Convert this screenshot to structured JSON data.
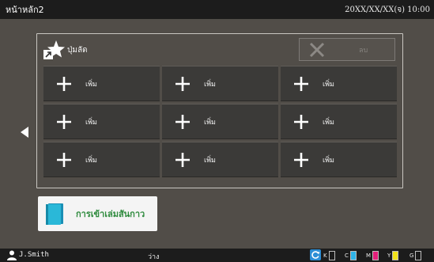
{
  "header": {
    "title": "หน้าหลัก2",
    "datetime": "20XX/XX/XX(จ) 10:00"
  },
  "shortcuts": {
    "title": "ปุ่มลัด",
    "delete_label": "ลบ",
    "delete_icon": "x-icon",
    "title_icon": "star-shortcut-icon",
    "tiles": [
      {
        "label": "เพิ่ม",
        "icon": "plus-icon"
      },
      {
        "label": "เพิ่ม",
        "icon": "plus-icon"
      },
      {
        "label": "เพิ่ม",
        "icon": "plus-icon"
      },
      {
        "label": "เพิ่ม",
        "icon": "plus-icon"
      },
      {
        "label": "เพิ่ม",
        "icon": "plus-icon"
      },
      {
        "label": "เพิ่ม",
        "icon": "plus-icon"
      },
      {
        "label": "เพิ่ม",
        "icon": "plus-icon"
      },
      {
        "label": "เพิ่ม",
        "icon": "plus-icon"
      },
      {
        "label": "เพิ่ม",
        "icon": "plus-icon"
      }
    ]
  },
  "navigation": {
    "prev_icon": "triangle-left-icon"
  },
  "booklet": {
    "label": "การเข้าเล่มสันกาว",
    "icon": "book-icon",
    "label_color": "#2d8a3c"
  },
  "status_bar": {
    "user": "J.Smith",
    "status": "ว่าง",
    "refresh_icon": "refresh-icon",
    "toner": [
      {
        "letter": "K",
        "color": "#1a1a1a",
        "level": 0.0
      },
      {
        "letter": "C",
        "color": "#2fb3e8",
        "level": 1.0
      },
      {
        "letter": "M",
        "color": "#e3207b",
        "level": 1.0
      },
      {
        "letter": "Y",
        "color": "#f1e21a",
        "level": 1.0
      },
      {
        "letter": "G",
        "color": "#9a9a9a",
        "level": 0.0
      }
    ]
  },
  "colors": {
    "background": "#514d48",
    "bars": "#1c1c1c",
    "tile": "#3b3a38"
  }
}
